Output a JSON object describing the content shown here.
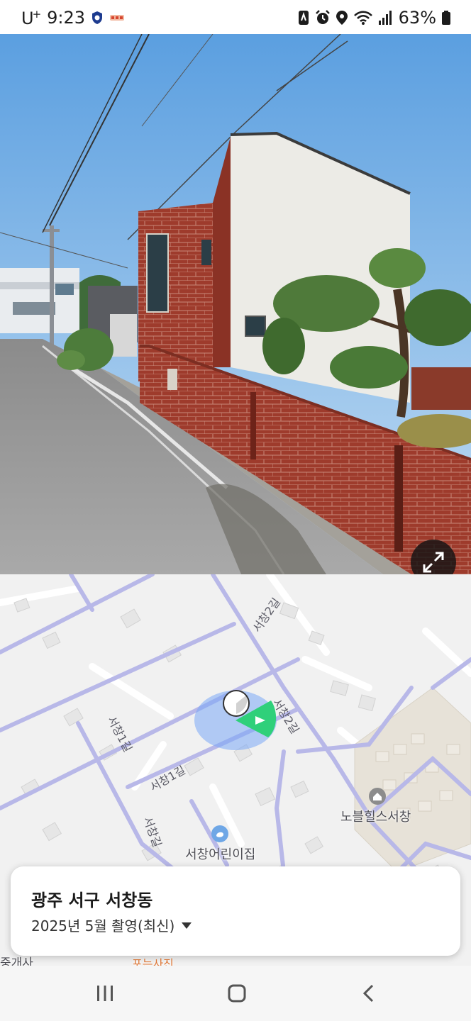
{
  "status_bar": {
    "carrier": "U",
    "carrier_superscript": "+",
    "time": "9:23",
    "battery_percent": "63%",
    "icons": [
      "shield-icon",
      "notification-icon",
      "nfc-icon",
      "alarm-icon",
      "location-icon",
      "wifi-icon",
      "signal-icon",
      "battery-icon"
    ]
  },
  "street_view": {
    "expand_icon": "expand-arrows-icon"
  },
  "map": {
    "road_labels": [
      "서창2길",
      "서창2길",
      "서창1길",
      "서창1길",
      "서창길"
    ],
    "pois": [
      {
        "name": "노블힐스서창",
        "icon": "home-icon"
      },
      {
        "name": "서창어린이집",
        "icon": "daycare-icon"
      }
    ],
    "partial_labels": [
      "중개사",
      "포는사진"
    ],
    "colors": {
      "road": "#b8b8e8",
      "viewpoint_cone": "#2fd07a",
      "viewpoint_circle": "#7aa7f5"
    }
  },
  "info_card": {
    "location": "광주 서구 서창동",
    "capture_date": "2025년 5월 촬영(최신)",
    "dropdown_icon": "caret-down-icon"
  },
  "nav_bar": {
    "icons": [
      "recent-apps-icon",
      "home-button-icon",
      "back-icon"
    ]
  }
}
